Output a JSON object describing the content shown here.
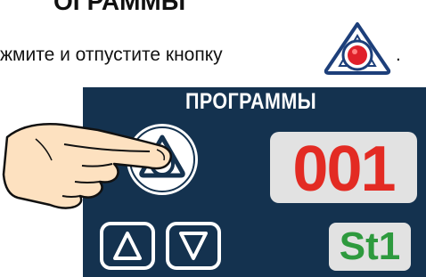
{
  "heading_fragment": "ОГРАММЫ",
  "instruction": {
    "text": "жмите и отпустите кнопку",
    "end_punct": ".",
    "icon": "program-button-icon"
  },
  "panel": {
    "title": "ПРОГРАММЫ",
    "program_button_icon": "program-button-icon",
    "display_value": "001",
    "status_value": "St1",
    "arrow_up_icon": "triangle-up-icon",
    "arrow_down_icon": "triangle-down-icon",
    "pointer_icon": "pointing-hand-icon"
  },
  "colors": {
    "panel_bg": "#14324f",
    "display_red": "#e32b23",
    "status_green": "#2e9a3e",
    "display_bg": "#e2e2e2",
    "accent_red": "#e0202a",
    "icon_blue": "#1d3f7a"
  }
}
